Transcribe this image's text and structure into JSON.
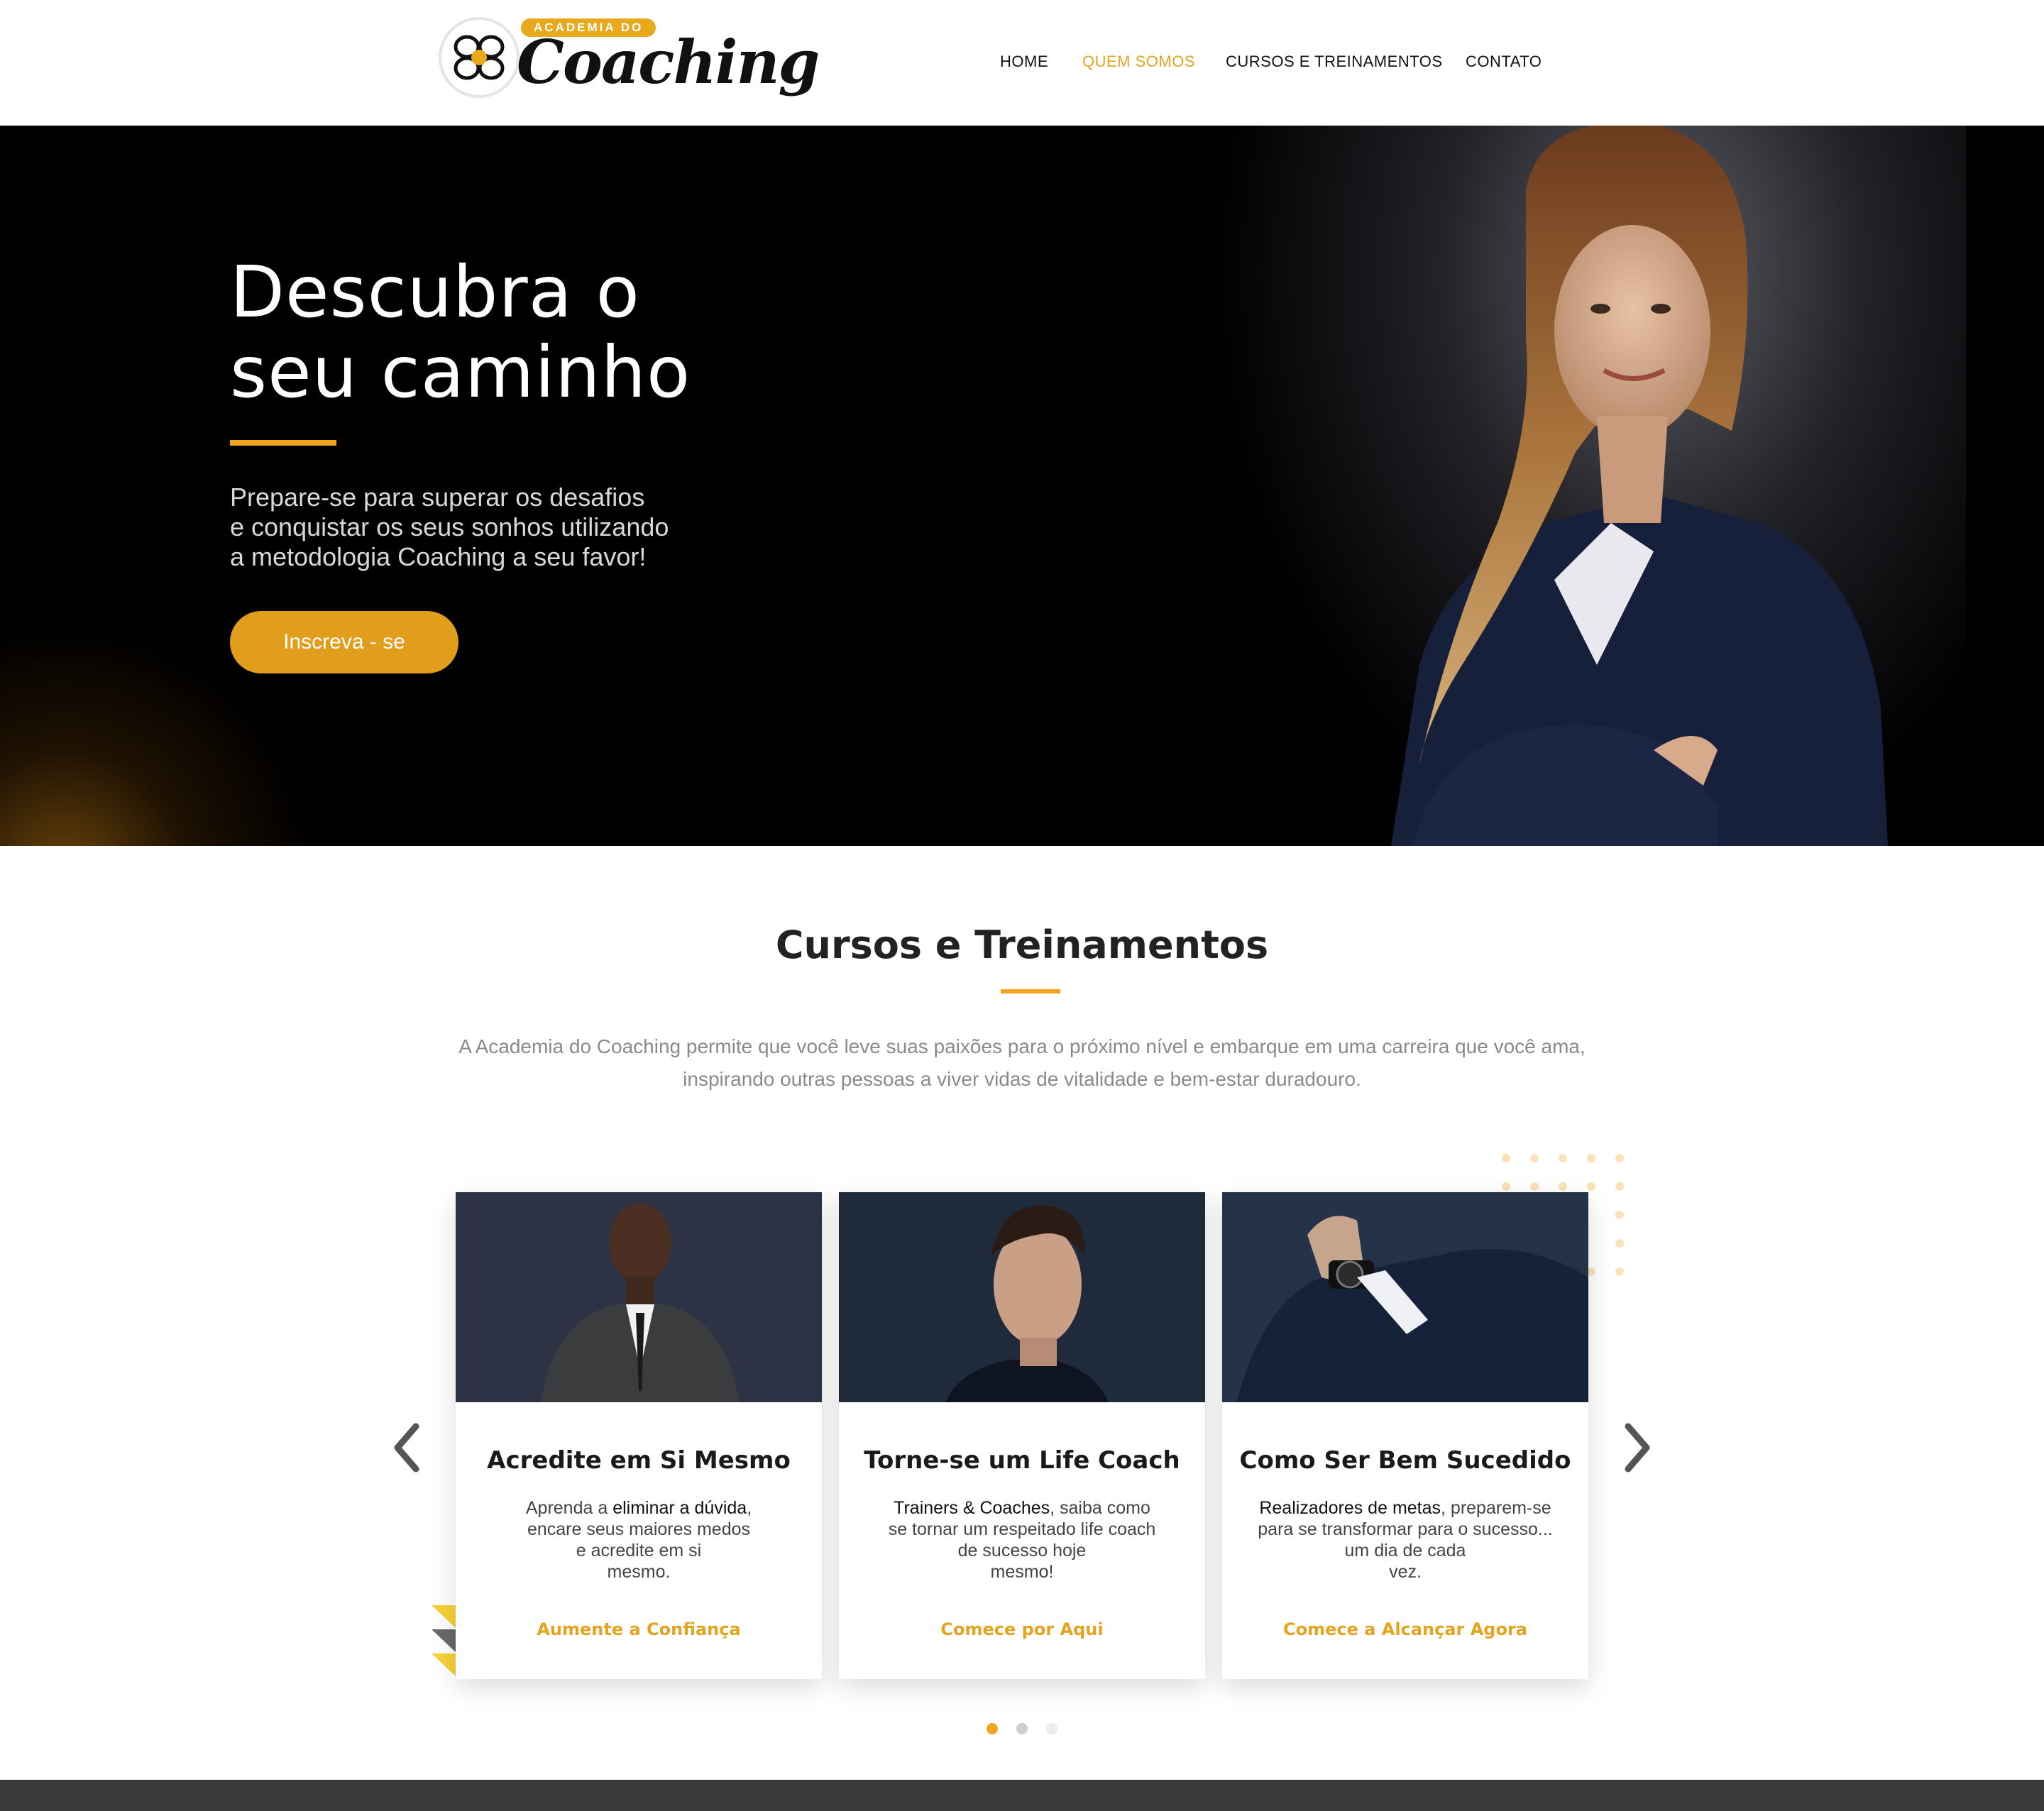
{
  "brand": {
    "badge": "ACADEMIA DO",
    "name": "Coaching",
    "accent_color": "#e8a91c"
  },
  "nav": {
    "items": [
      {
        "label": "HOME",
        "active": false
      },
      {
        "label": "QUEM SOMOS",
        "active": true
      },
      {
        "label": "CURSOS E TREINAMENTOS",
        "active": false
      },
      {
        "label": "CONTATO",
        "active": false
      }
    ]
  },
  "hero": {
    "title_line1": "Descubra o",
    "title_line2": "seu caminho",
    "subtitle_line1": "Prepare-se para superar os desafios",
    "subtitle_line2": "e conquistar os seus sonhos utilizando",
    "subtitle_line3": "a metodologia  Coaching a seu favor!",
    "cta_label": "Inscreva - se"
  },
  "courses": {
    "title": "Cursos e Treinamentos",
    "description_line1": "A Academia do Coaching permite que você leve suas paixões para o próximo nível e embarque em uma carreira que você ama,",
    "description_line2": "inspirando outras pessoas a viver vidas de vitalidade e bem-estar duradouro.",
    "cards": [
      {
        "title": "Acredite em Si Mesmo",
        "text_l1_a": "Aprenda a ",
        "text_l1_b": "eliminar a  dúvida",
        "text_l1_c": ",",
        "text_l2": "encare seus maiores  medos",
        "text_l3": "e acredite em si",
        "text_l4": "mesmo.",
        "link": "Aumente a Confiança"
      },
      {
        "title": "Torne-se um Life Coach",
        "text_l1_a": "",
        "text_l1_b": "Trainers & Coaches",
        "text_l1_c": ", saiba como",
        "text_l2": "se tornar um respeitado life coach",
        "text_l3": "de sucesso hoje",
        "text_l4": "mesmo!",
        "link": "Comece por Aqui"
      },
      {
        "title": "Como Ser Bem Sucedido",
        "text_l1_a": "",
        "text_l1_b": "Realizadores de metas",
        "text_l1_c": ", preparem-se",
        "text_l2": "para se transformar para o sucesso...",
        "text_l3": "um dia de cada",
        "text_l4": "vez.",
        "link": "Comece a Alcançar Agora"
      }
    ],
    "pager": {
      "count": 3,
      "active": 1
    }
  }
}
